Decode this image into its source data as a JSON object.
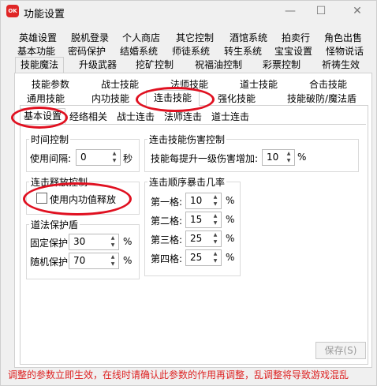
{
  "title": "功能设置",
  "app_icon_text": "OK",
  "window_buttons": {
    "minimize": "—",
    "maximize": "☐",
    "close": "✕"
  },
  "tabs_row1": [
    "英雄设置",
    "脱机登录",
    "个人商店",
    "其它控制",
    "酒馆系统",
    "拍卖行",
    "角色出售"
  ],
  "tabs_row2": [
    "基本功能",
    "密码保护",
    "结婚系统",
    "师徒系统",
    "转生系统",
    "宝宝设置",
    "怪物说话"
  ],
  "tabs_row3": [
    "技能魔法",
    "升级武器",
    "挖矿控制",
    "祝福油控制",
    "彩票控制",
    "祈祷生效"
  ],
  "skill_tabs_row1": [
    "技能参数",
    "战士技能",
    "法师技能",
    "道士技能",
    "合击技能"
  ],
  "skill_tabs_row2": [
    "通用技能",
    "内功技能",
    "连击技能",
    "强化技能",
    "技能破防/魔法盾"
  ],
  "sub_tabs": [
    "基本设置",
    "经络相关",
    "战士连击",
    "法师连击",
    "道士连击"
  ],
  "time_control": {
    "title": "时间控制",
    "label": "使用间隔:",
    "value": "0",
    "unit": "秒"
  },
  "damage_control": {
    "title": "连击技能伤害控制",
    "label": "技能每提升一级伤害增加:",
    "value": "10",
    "unit": "%"
  },
  "release_control": {
    "title": "连击释放控制",
    "checkbox_label": "使用内功值释放"
  },
  "shield": {
    "title": "道法保护盾",
    "rows": [
      {
        "label": "固定保护:",
        "value": "30",
        "unit": "%"
      },
      {
        "label": "随机保护:",
        "value": "70",
        "unit": "%"
      }
    ]
  },
  "crit": {
    "title": "连击顺序暴击几率",
    "rows": [
      {
        "label": "第一格:",
        "value": "10",
        "unit": "%"
      },
      {
        "label": "第二格:",
        "value": "15",
        "unit": "%"
      },
      {
        "label": "第三格:",
        "value": "25",
        "unit": "%"
      },
      {
        "label": "第四格:",
        "value": "25",
        "unit": "%"
      }
    ]
  },
  "save_label": "保存(S)",
  "status_text": "调整的参数立即生效，在线时请确认此参数的作用再调整，乱调整将导致游戏混乱",
  "colors": {
    "status": "#dd2222",
    "annotation": "#e01020",
    "icon": "#e02626"
  }
}
